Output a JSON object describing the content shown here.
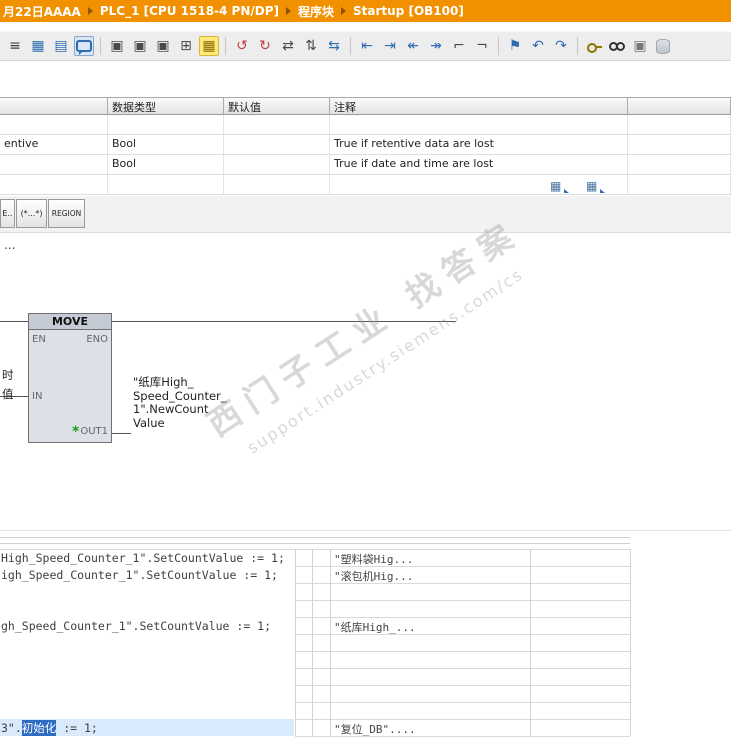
{
  "colors": {
    "accent_orange": "#F29100",
    "selection_blue": "#2E6BC4",
    "line_highlight": "#D8EAFB",
    "block_fill": "#DDE0E6",
    "out_star_green": "#14A014"
  },
  "breadcrumb": {
    "items": [
      "月22日AAAA",
      "PLC_1 [CPU 1518-4 PN/DP]",
      "程序块",
      "Startup [OB100]"
    ]
  },
  "toolbar": {
    "icons": [
      {
        "name": "insert-network-icon",
        "glyph": "≡",
        "color": "#3f3f3f"
      },
      {
        "name": "network-overview-icon",
        "glyph": "▦",
        "color": "#2f6db0"
      },
      {
        "name": "show-comments-icon",
        "glyph": "▤",
        "color": "#2f6db0"
      },
      {
        "name": "free-comment-bubble-icon",
        "type": "bubble",
        "pressed": true,
        "sep_after": true
      },
      {
        "name": "insert-box-down-icon",
        "glyph": "▣",
        "color": "#4a4a4a"
      },
      {
        "name": "insert-box-up-icon",
        "glyph": "▣",
        "color": "#4a4a4a"
      },
      {
        "name": "insert-box-branch-icon",
        "glyph": "▣",
        "color": "#4a4a4a"
      },
      {
        "name": "insert-empty-box-icon",
        "glyph": "⊞",
        "color": "#4a4a4a"
      },
      {
        "name": "structure-highlight-icon",
        "glyph": "▦",
        "color": "#8a6d00",
        "highlight": true,
        "sep_after": true
      },
      {
        "name": "goto-prev-error-icon",
        "glyph": "↺",
        "color": "#C43B3B"
      },
      {
        "name": "goto-next-error-icon",
        "glyph": "↻",
        "color": "#C43B3B"
      },
      {
        "name": "update-block-calls-icon",
        "glyph": "⇄",
        "color": "#4a4a4a"
      },
      {
        "name": "consistency-check-icon",
        "glyph": "⇅",
        "color": "#4a4a4a"
      },
      {
        "name": "absolute-symbolic-toggle-icon",
        "glyph": "⇆",
        "color": "#2f6db0",
        "sep_after": true
      },
      {
        "name": "indent-left-icon",
        "glyph": "⇤",
        "color": "#2f6db0"
      },
      {
        "name": "indent-right-icon",
        "glyph": "⇥",
        "color": "#2f6db0"
      },
      {
        "name": "outdent-region-icon",
        "glyph": "↞",
        "color": "#2f6db0"
      },
      {
        "name": "indent-region-icon",
        "glyph": "↠",
        "color": "#2f6db0"
      },
      {
        "name": "line-numbers-icon",
        "glyph": "⌐",
        "color": "#4a4a4a"
      },
      {
        "name": "symbol-information-icon",
        "glyph": "¬",
        "color": "#4a4a4a",
        "sep_after": true
      },
      {
        "name": "favorites-flag-icon",
        "glyph": "⚑",
        "color": "#2f6db0"
      },
      {
        "name": "navigate-back-icon",
        "glyph": "↶",
        "color": "#2f6db0"
      },
      {
        "name": "navigate-forward-icon",
        "glyph": "↷",
        "color": "#2f6db0",
        "sep_after": true
      },
      {
        "name": "know-how-protection-key-icon",
        "type": "key"
      },
      {
        "name": "monitoring-glasses-icon",
        "type": "glasses"
      },
      {
        "name": "snapshot-icon",
        "glyph": "▣",
        "color": "#777777"
      },
      {
        "name": "data-block-icon",
        "type": "cyl"
      }
    ]
  },
  "var_table": {
    "headers": [
      "",
      "数据类型",
      "默认值",
      "注释",
      ""
    ],
    "rows": [
      [
        "",
        "",
        "",
        ""
      ],
      [
        "entive",
        "Bool",
        "",
        "True if retentive data are lost"
      ],
      [
        "",
        "Bool",
        "",
        "True if date and time are lost"
      ],
      [
        "",
        "",
        "",
        ""
      ]
    ]
  },
  "misc": {
    "mini_icon_glyph": "▦"
  },
  "snippet_buttons": [
    {
      "label": "E.."
    },
    {
      "label": "(*...*)"
    },
    {
      "label": "REGION"
    }
  ],
  "network": {
    "comment": "...",
    "move_block": {
      "title": "MOVE",
      "pins": {
        "en": "EN",
        "eno": "ENO",
        "in": "IN",
        "out": "OUT1"
      },
      "out_star": "*"
    },
    "left_operand_fragments": [
      "时",
      "值"
    ],
    "out_operand_lines": [
      "\"纸库High_",
      "Speed_Counter_",
      "1\".NewCount",
      "Value"
    ]
  },
  "watermark": {
    "line1": "西门子工业  找答案",
    "line2": "support.industry.siemens.com/cs"
  },
  "scl": {
    "code_lines": [
      {
        "row": 0,
        "text": "High_Speed_Counter_1\".SetCountValue := 1;"
      },
      {
        "row": 1,
        "text": "igh_Speed_Counter_1\".SetCountValue := 1;"
      },
      {
        "row": 4,
        "text": "gh_Speed_Counter_1\".SetCountValue := 1;"
      }
    ],
    "comments": [
      {
        "row": 0,
        "text": "\"塑料袋Hig..."
      },
      {
        "row": 1,
        "text": "\"滚包机Hig..."
      },
      {
        "row": 4,
        "text": "\"纸库High_..."
      },
      {
        "row": 10,
        "text": "\"复位_DB\"...."
      }
    ],
    "selected_line": {
      "row": 10,
      "prefix": "3\".",
      "token": "初始化",
      "suffix": " := 1;"
    }
  }
}
